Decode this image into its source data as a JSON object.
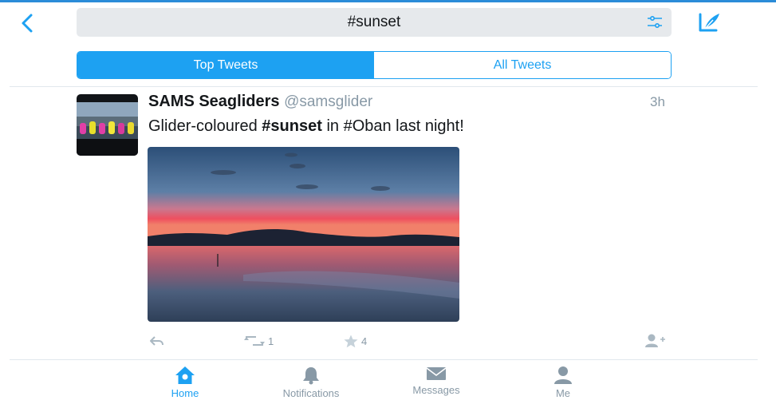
{
  "header": {
    "search_query": "#sunset",
    "icons": {
      "back": "chevron-left-icon",
      "filter": "filter-sliders-icon",
      "compose": "compose-quill-icon"
    }
  },
  "segments": [
    {
      "label": "Top Tweets",
      "active": true
    },
    {
      "label": "All Tweets",
      "active": false
    }
  ],
  "tweet": {
    "name": "SAMS Seagliders",
    "handle": "@samsglider",
    "time": "3h",
    "text_prefix": "Glider-coloured ",
    "text_hashtag": "#sunset",
    "text_suffix": " in #Oban last night!",
    "retweet_count": "1",
    "favorite_count": "4"
  },
  "tabbar": [
    {
      "label": "Home",
      "icon": "home-icon",
      "active": true
    },
    {
      "label": "Notifications",
      "icon": "bell-icon",
      "active": false
    },
    {
      "label": "Messages",
      "icon": "envelope-icon",
      "active": false
    },
    {
      "label": "Me",
      "icon": "person-icon",
      "active": false
    }
  ],
  "colors": {
    "accent": "#1da1f2",
    "muted": "#8899a6",
    "search_bg": "#e6e9ec"
  }
}
